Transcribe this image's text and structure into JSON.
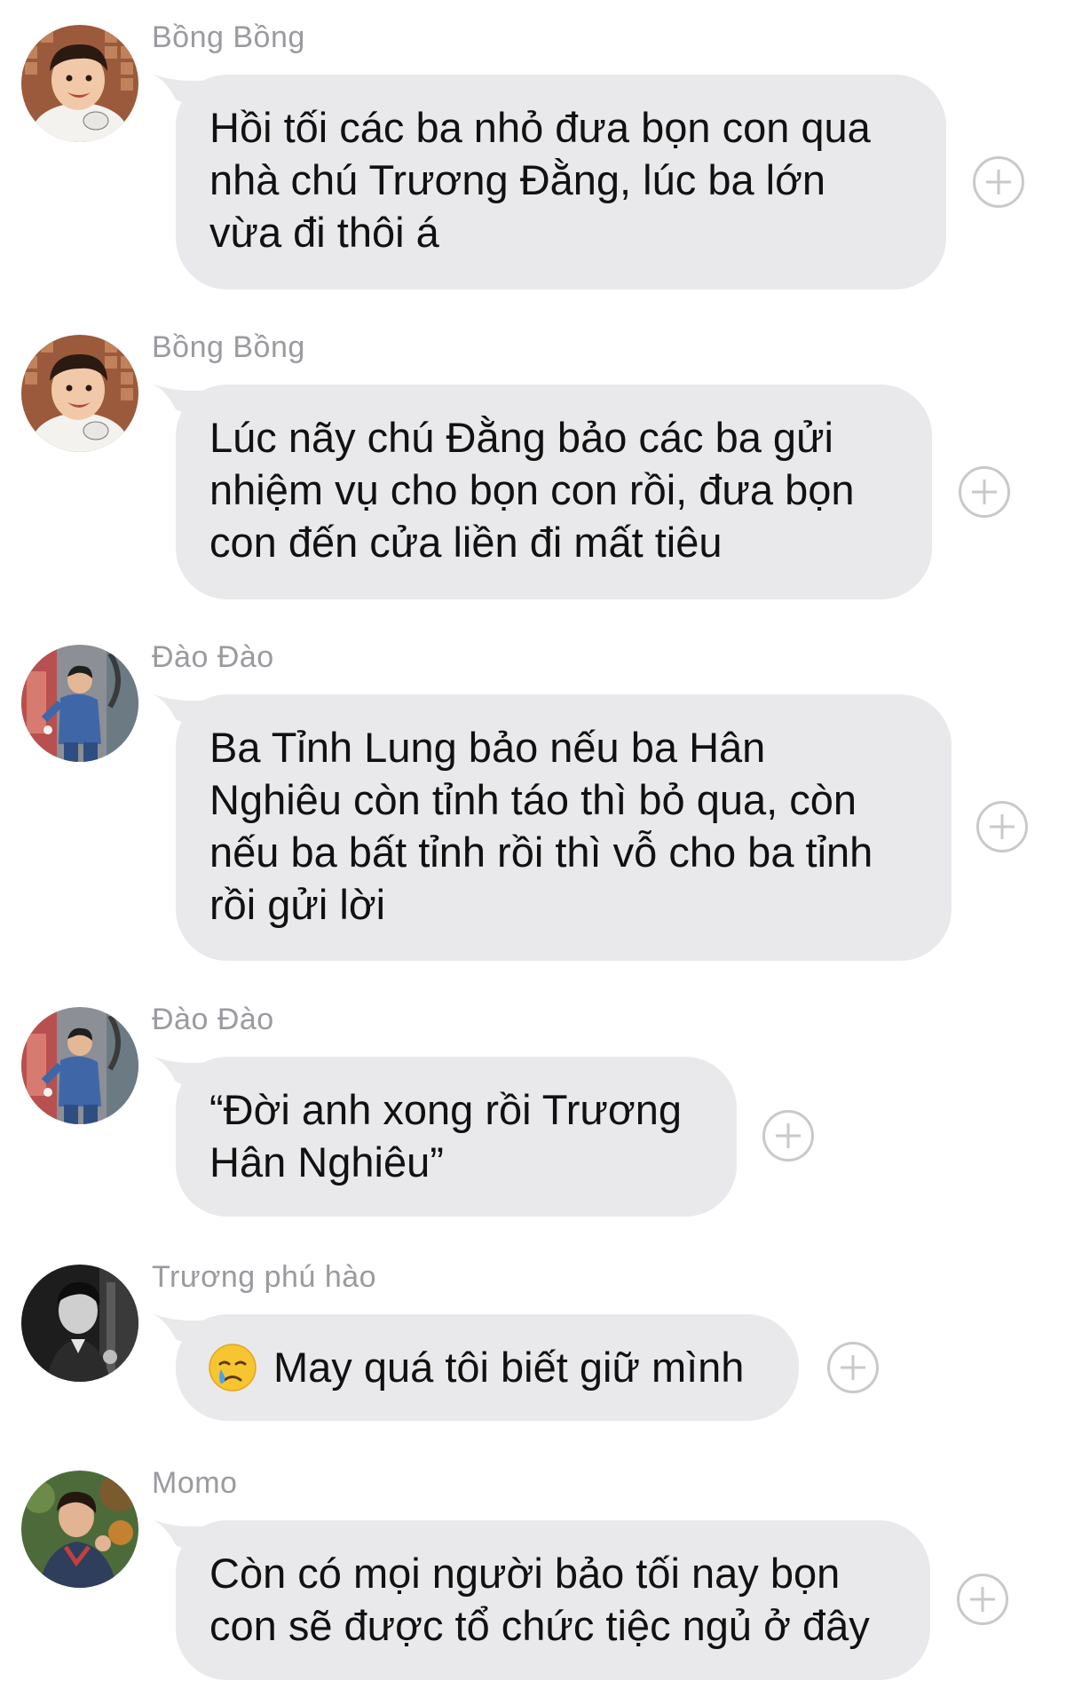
{
  "messages": [
    {
      "sender": "Bồng Bồng",
      "text": "Hồi tối các ba nhỏ đưa bọn con qua\nnhà chú Trương Đằng, lúc ba lớn\nvừa đi thôi á",
      "avatar_icon": "child-portrait-avatar",
      "action_icon": "add-reaction-icon"
    },
    {
      "sender": "Bồng Bồng",
      "text": "Lúc nãy chú Đằng bảo các ba gửi\nnhiệm vụ cho bọn con rồi, đưa bọn\ncon đến cửa liền đi mất tiêu",
      "avatar_icon": "child-portrait-avatar",
      "action_icon": "add-reaction-icon"
    },
    {
      "sender": "Đào Đào",
      "text": "Ba Tỉnh Lung bảo nếu ba Hân\nNghiêu còn tỉnh táo thì bỏ qua, còn\nnếu ba bất tỉnh rồi thì vỗ cho ba tỉnh\nrồi gửi lời",
      "avatar_icon": "child-playing-avatar",
      "action_icon": "add-reaction-icon"
    },
    {
      "sender": "Đào Đào",
      "text": "“Đời anh xong rồi Trương\nHân Nghiêu”",
      "avatar_icon": "child-playing-avatar",
      "action_icon": "add-reaction-icon"
    },
    {
      "sender": "Trương phú hào",
      "emoji": "crying-face-emoji",
      "text": "May quá tôi biết giữ mình",
      "avatar_icon": "black-white-portrait-avatar",
      "action_icon": "add-reaction-icon"
    },
    {
      "sender": "Momo",
      "text": "Còn có mọi người bảo tối nay bọn\ncon sẽ được tổ chức tiệc ngủ ở đây",
      "avatar_icon": "child-outdoor-avatar",
      "action_icon": "add-reaction-icon"
    }
  ],
  "colors": {
    "bubble": "#e9e9eb",
    "sender_name": "#9a9a9f",
    "text": "#111111",
    "add_button": "#c9c9cc"
  }
}
